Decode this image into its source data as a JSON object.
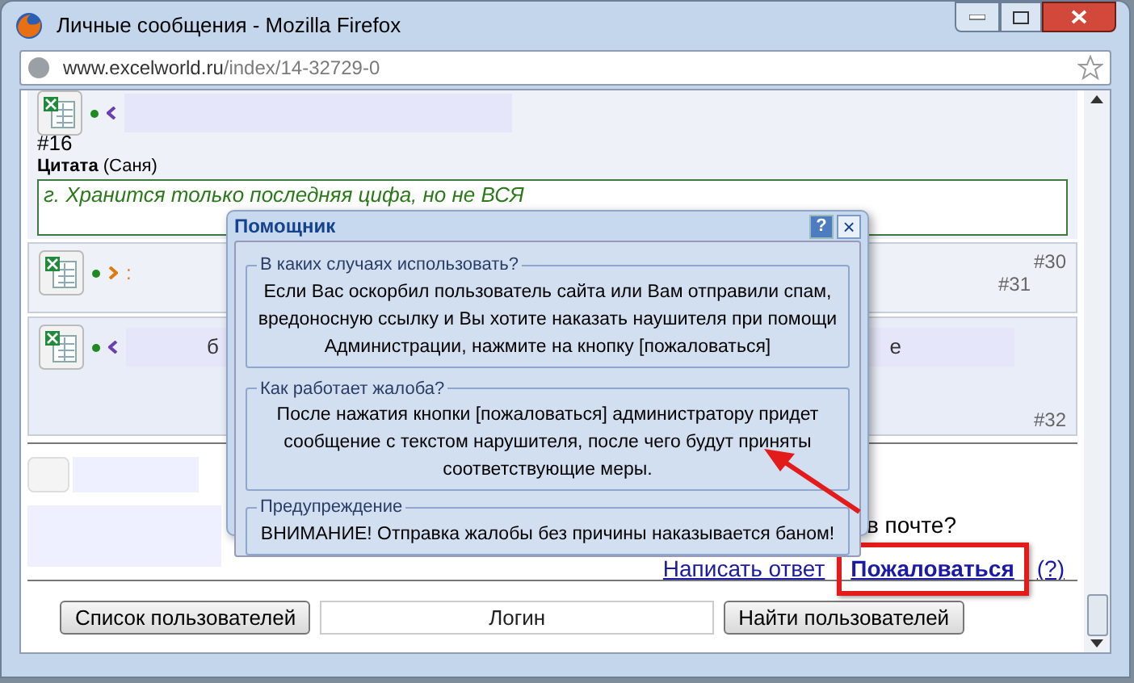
{
  "window": {
    "title": "Личные сообщения - Mozilla Firefox"
  },
  "address_bar": {
    "url_host": "www.excelworld.ru",
    "url_path": "/index/14-32729-0"
  },
  "posts": [
    {
      "kind": "incoming",
      "numbers": [
        "#16"
      ],
      "quote": {
        "label": "Цитата",
        "author": "(Саня)",
        "text": "г. Хранится только последняя цифа, но не ВСЯ"
      }
    },
    {
      "kind": "outgoing",
      "fragments": [
        ":"
      ],
      "numbers": [
        "#30",
        "#31"
      ]
    },
    {
      "kind": "incoming",
      "fragments": [
        "б",
        "е"
      ],
      "numbers": [
        "#32"
      ]
    }
  ],
  "reply_area": {
    "question": "в почте?",
    "links": [
      {
        "label": "Написать ответ",
        "highlighted": false
      },
      {
        "label": "Пожаловаться",
        "highlighted": true
      },
      {
        "label": "(?)",
        "highlighted": false
      }
    ]
  },
  "user_search": {
    "list_button": "Список пользователей",
    "login_field": {
      "placeholder": "Логин"
    },
    "find_button": "Найти пользователей"
  },
  "dialog": {
    "title": "Помощник",
    "help_button": "?",
    "close_button": "×",
    "sections": [
      {
        "legend": "В каких случаях использовать?",
        "text": "Если Вас оскорбил пользователь сайта или Вам отправили спам, вредоносную ссылку и Вы хотите наказать наушителя при помощи Администрации, нажмите на кнопку [пожаловаться]"
      },
      {
        "legend": "Как работает жалоба?",
        "text": "После нажатия кнопки [пожаловаться] администратору придет сообщение с текстом нарушителя, после чего будут приняты соответствующие меры."
      },
      {
        "legend": "Предупреждение",
        "text": "ВНИМАНИЕ! Отправка жалобы без причины наказывается баном!"
      }
    ]
  }
}
